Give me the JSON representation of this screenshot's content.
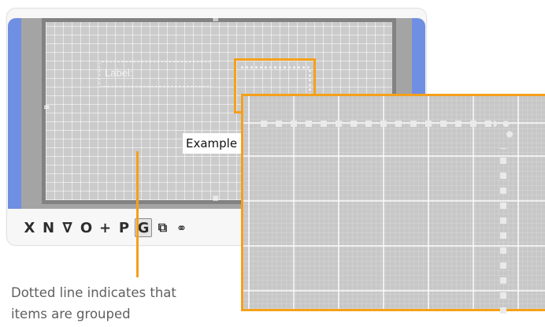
{
  "editor": {
    "form_label": "Label:",
    "example_text": "Example",
    "toolbar": [
      {
        "name": "delete-tool",
        "glyph": "X",
        "active": false
      },
      {
        "name": "new-tool",
        "glyph": "N",
        "active": false
      },
      {
        "name": "triangle-tool",
        "glyph": "∇",
        "active": false
      },
      {
        "name": "circle-tool",
        "glyph": "O",
        "active": false
      },
      {
        "name": "add-tool",
        "glyph": "+",
        "active": false
      },
      {
        "name": "p-tool",
        "glyph": "P",
        "active": false
      },
      {
        "name": "group-tool",
        "glyph": "G",
        "active": true
      },
      {
        "name": "window-tool",
        "glyph": "⧉",
        "active": false
      },
      {
        "name": "link-tool",
        "glyph": "⚭",
        "active": false
      }
    ]
  },
  "callout": {
    "caption_line1": "Dotted line indicates that",
    "caption_line2": "items are grouped"
  },
  "colors": {
    "highlight": "#f5a01a",
    "side_strip": "#6f8fe3"
  }
}
